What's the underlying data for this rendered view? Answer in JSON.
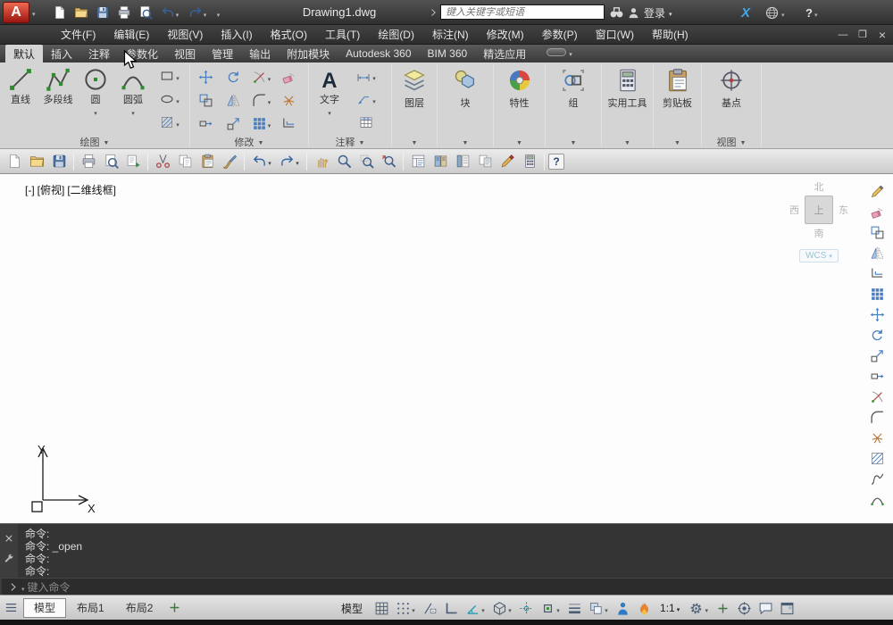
{
  "colors": {
    "titlebar_bg": "#3a3a3a",
    "logo_red": "#b81a12",
    "accent_blue": "#4a7fc0",
    "ribbon_bg": "#d4d4d4",
    "command_bg": "#343434",
    "status_bg": "#d8d8d8",
    "canvas_bg": "#fdfdfd",
    "viewcube_text": "#b4b4b4",
    "wcs_text": "#9fc0d4",
    "exchange_blue": "#45a6e8"
  },
  "icons": {
    "caret-down-icon": "▾",
    "panel-expand-icon": "▼",
    "scissors-icon": "✂",
    "gear-icon": "⚙",
    "undo-icon": "↶",
    "redo-icon": "↷",
    "zoom-icon": "○─",
    "pencil-icon": "✎",
    "close-icon": "×",
    "minimize-icon": "—",
    "restore-icon": "❒",
    "plus-icon": "+",
    "binoculars-icon": "◎◎",
    "user-icon": "👤",
    "grid-icon": "▦",
    "hamburger-icon": "☰"
  },
  "title_bar": {
    "logo_letter": "A",
    "title": "Drawing1.dwg",
    "search_placeholder": "键入关键字或短语",
    "login_label": "登录",
    "exchange_label": "X",
    "help_label": "?"
  },
  "menu_bar": {
    "items": [
      "文件(F)",
      "编辑(E)",
      "视图(V)",
      "插入(I)",
      "格式(O)",
      "工具(T)",
      "绘图(D)",
      "标注(N)",
      "修改(M)",
      "参数(P)",
      "窗口(W)",
      "帮助(H)"
    ]
  },
  "ribbon": {
    "tabs": [
      "默认",
      "插入",
      "注释",
      "参数化",
      "视图",
      "管理",
      "输出",
      "附加模块",
      "Autodesk 360",
      "BIM 360",
      "精选应用"
    ],
    "active_tab": "默认",
    "panels": {
      "draw": {
        "label": "绘图",
        "big_tools": [
          "直线",
          "多段线",
          "圆",
          "圆弧"
        ]
      },
      "modify": {
        "label": "修改"
      },
      "annotate": {
        "label": "注释",
        "text_tool": "文字"
      },
      "layers": {
        "label": "图层"
      },
      "block": {
        "label": "块"
      },
      "properties": {
        "label": "特性"
      },
      "group": {
        "label": "组"
      },
      "utilities": {
        "label": "实用工具"
      },
      "clipboard": {
        "label": "剪贴板"
      },
      "view": {
        "label": "视图",
        "tool": "基点"
      }
    }
  },
  "viewport": {
    "controls": [
      "[-]",
      "[俯视]",
      "[二维线框]"
    ],
    "viewcube": {
      "north": "北",
      "west": "西",
      "east": "东",
      "south": "南",
      "top": "上",
      "wcs_label": "WCS"
    },
    "ucs_y": "Y",
    "ucs_x": "X"
  },
  "command_line": {
    "history": [
      "命令:",
      "命令: _open",
      "命令:",
      "命令:"
    ],
    "input_placeholder": "键入命令"
  },
  "status_bar": {
    "layout_tabs": [
      "模型",
      "布局1",
      "布局2"
    ],
    "active_layout_tab": "模型",
    "model_space_label": "模型",
    "annotation_scale": "1:1"
  }
}
